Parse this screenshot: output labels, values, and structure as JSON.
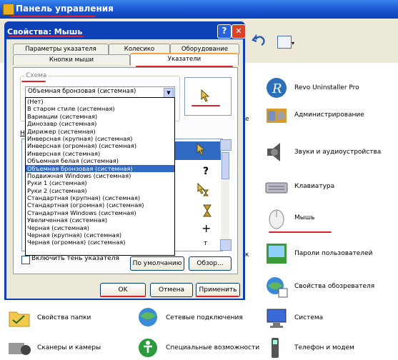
{
  "control_panel": {
    "title": "Панель управления",
    "items": [
      {
        "label": "Revo Uninstaller Pro"
      },
      {
        "label": "Администрирование"
      },
      {
        "label": "Звуки и аудиоустройства"
      },
      {
        "label": "Клавиатура"
      },
      {
        "label": "Мышь"
      },
      {
        "label": "Пароли пользователей"
      },
      {
        "label": "Свойства обозревателя"
      },
      {
        "label": "Свойства папки"
      },
      {
        "label": "Сетевые подключения"
      },
      {
        "label": "Система"
      },
      {
        "label": "Сканеры и камеры"
      },
      {
        "label": "Специальные возможности"
      },
      {
        "label": "Телефон и модем"
      }
    ]
  },
  "dialog": {
    "title": "Свойства: Мышь",
    "help_label": "?",
    "close_label": "✕",
    "tabs_row1": [
      "Параметры указателя",
      "Колесико",
      "Оборудование"
    ],
    "tabs_row2": [
      "Кнопки мыши",
      "Указатели"
    ],
    "scheme_label": "Схема",
    "scheme_value": "Объемная бронзовая (системная)",
    "scheme_options": [
      "(Нет)",
      "В старом стиле (системная)",
      "Вариации (системная)",
      "Динозавр (системная)",
      "Дирижер (системная)",
      "Инверсная (крупная) (системная)",
      "Инверсная (огромная) (системная)",
      "Инверсная (системная)",
      "Объемная белая (системная)",
      "Объемная бронзовая (системная)",
      "Подвижная Windows (системная)",
      "Руки 1 (системная)",
      "Руки 2 (системная)",
      "Стандартная (крупная) (системная)",
      "Стандартная (огромная) (системная)",
      "Стандартная Windows (системная)",
      "Увеличенная (системная)",
      "Черная (системная)",
      "Черная (крупная) (системная)",
      "Черная (огромная) (системная)"
    ],
    "selected_index": 9,
    "shadow_label": "Включить тень указателя",
    "default_button": "По умолчанию",
    "browse_button": "Обзор...",
    "ok_button": "OK",
    "cancel_button": "Отмена",
    "apply_button": "Применить",
    "h_letter": "Н"
  },
  "colors": {
    "titlebar": "#1d5ad6",
    "selection": "#316ac5",
    "annotation": "#e0202a"
  }
}
